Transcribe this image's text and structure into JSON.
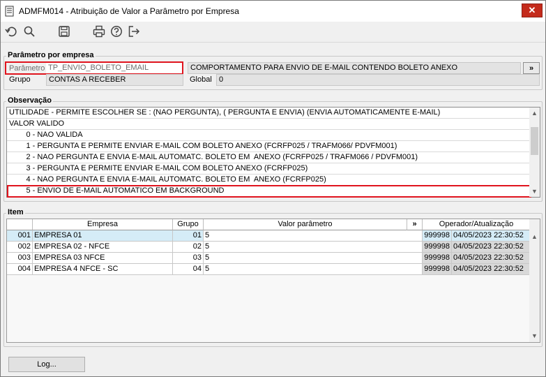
{
  "window": {
    "title": "ADMFM014 - Atribuição de Valor a Parâmetro por Empresa",
    "close_glyph": "✕"
  },
  "toolbar": {
    "icons": [
      "undo-icon",
      "search-icon",
      "save-icon",
      "print-icon",
      "help-icon",
      "exit-icon"
    ]
  },
  "param_group": {
    "legend": "Parâmetro por empresa",
    "parametro_label": "Parâmetro",
    "parametro_value": "TP_ENVIO_BOLETO_EMAIL",
    "descricao_value": "COMPORTAMENTO PARA ENVIO DE E-MAIL CONTENDO BOLETO ANEXO",
    "expand_label": "»",
    "grupo_label": "Grupo",
    "grupo_value": "CONTAS A RECEBER",
    "global_label": "Global",
    "global_value": "0"
  },
  "observacao": {
    "legend": "Observação",
    "lines": [
      "UTILIDADE - PERMITE ESCOLHER SE : (NAO PERGUNTA), ( PERGUNTA E ENVIA) (ENVIA AUTOMATICAMENTE E-MAIL)",
      "VALOR VALIDO",
      "        0 - NAO VALIDA",
      "        1 - PERGUNTA E PERMITE ENVIAR E-MAIL COM BOLETO ANEXO (FCRFP025 / TRAFM066/ PDVFM001)",
      "        2 - NAO PERGUNTA E ENVIA E-MAIL AUTOMATC. BOLETO EM  ANEXO (FCRFP025 / TRAFM066 / PDVFM001)",
      "        3 - PERGUNTA E PERMITE ENVIAR E-MAIL COM BOLETO ANEXO (FCRFP025)",
      "        4 - NAO PERGUNTA E ENVIA E-MAIL AUTOMATC. BOLETO EM  ANEXO (FCRFP025)",
      "        5 - ENVIO DE E-MAIL AUTOMATICO EM BACKGROUND"
    ],
    "scroll_up": "▲",
    "scroll_down": "▼"
  },
  "item": {
    "legend": "Item",
    "headers": {
      "empresa": "Empresa",
      "grupo": "Grupo",
      "valor": "Valor parâmetro",
      "expand": "»",
      "operador": "Operador/Atualização"
    },
    "rows": [
      {
        "code": "001",
        "empresa": "EMPRESA 01",
        "grupo": "01",
        "valor": "5",
        "operador": "999998",
        "data": "04/05/2023 22:30:52"
      },
      {
        "code": "002",
        "empresa": "EMPRESA 02 - NFCE",
        "grupo": "02",
        "valor": "5",
        "operador": "999998",
        "data": "04/05/2023 22:30:52"
      },
      {
        "code": "003",
        "empresa": "EMPRESA 03 NFCE",
        "grupo": "03",
        "valor": "5",
        "operador": "999998",
        "data": "04/05/2023 22:30:52"
      },
      {
        "code": "004",
        "empresa": "EMPRESA 4 NFCE - SC",
        "grupo": "04",
        "valor": "5",
        "operador": "999998",
        "data": "04/05/2023 22:30:52"
      }
    ]
  },
  "footer": {
    "log_label": "Log..."
  }
}
